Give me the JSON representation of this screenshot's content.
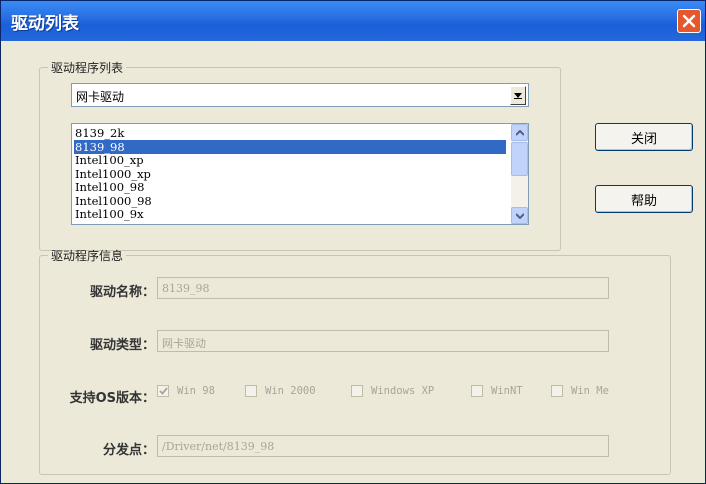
{
  "window": {
    "title": "驱动列表"
  },
  "driver_list_group": {
    "legend": "驱动程序列表",
    "category_select": {
      "value": "网卡驱动"
    },
    "drivers": [
      "8139_2k",
      "8139_98",
      "Intel100_xp",
      "Intel1000_xp",
      "Intel100_98",
      "Intel1000_98",
      "Intel100_9x"
    ],
    "selected_index": 1
  },
  "buttons": {
    "close_label": "关闭",
    "help_label": "帮助"
  },
  "driver_info_group": {
    "legend": "驱动程序信息",
    "name_label": "驱动名称：",
    "name_value": "8139_98",
    "type_label": "驱动类型：",
    "type_value": "网卡驱动",
    "os_label": "支持OS版本：",
    "os_options": [
      {
        "label": "Win 98",
        "checked": true
      },
      {
        "label": "Win 2000",
        "checked": false
      },
      {
        "label": "Windows XP",
        "checked": false
      },
      {
        "label": "WinNT",
        "checked": false
      },
      {
        "label": "Win Me",
        "checked": false
      }
    ],
    "dist_label": "分发点：",
    "dist_value": "/Driver/net/8139_98"
  },
  "icons": {
    "close": "close-icon",
    "dropdown": "chevron-down-icon",
    "scroll_up": "scroll-up-icon",
    "scroll_down": "scroll-down-icon",
    "check": "check-icon"
  }
}
